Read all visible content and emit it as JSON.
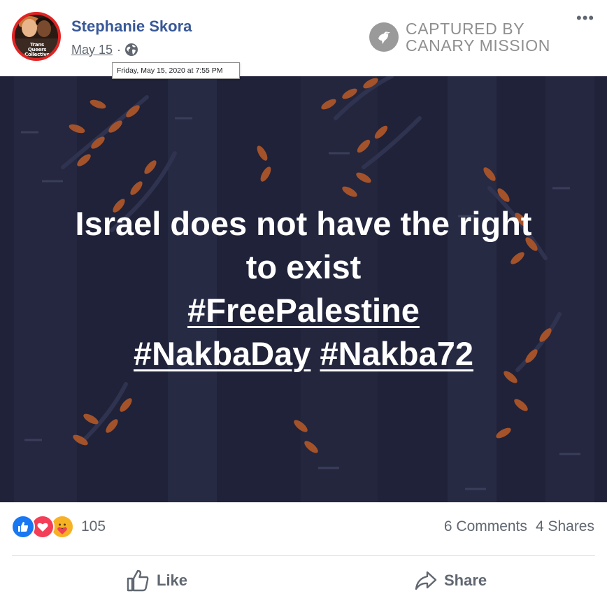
{
  "post": {
    "author": "Stephanie Skora",
    "date": "May 15",
    "separator": "·",
    "tooltip": "Friday, May 15, 2020 at 7:55 PM",
    "avatar_text": "Trans Queers Collective",
    "privacy_icon": "globe-icon",
    "more_label": "•••"
  },
  "watermark": {
    "line1": "CAPTURED BY",
    "line2": "CANARY MISSION",
    "icon": "bird-icon"
  },
  "image": {
    "line1": "Israel does not have the right",
    "line2": "to exist",
    "tag1": "#FreePalestine",
    "tag2": "#NakbaDay",
    "tag3": "#Nakba72",
    "background_color": "#1f2238",
    "accent_color": "#a4522a"
  },
  "footer": {
    "reaction_icons": [
      "like-icon",
      "love-icon",
      "care-icon"
    ],
    "reaction_count": "105",
    "comments": "6 Comments",
    "shares": "4 Shares",
    "like_label": "Like",
    "share_label": "Share"
  }
}
